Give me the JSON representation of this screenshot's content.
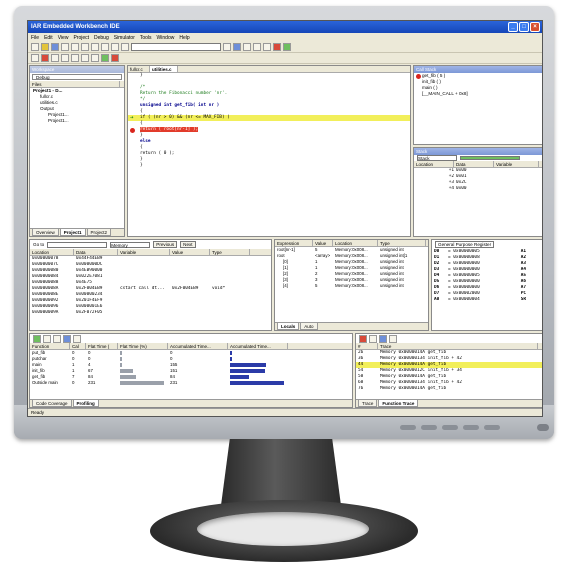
{
  "app": {
    "title": "IAR Embedded Workbench IDE"
  },
  "menu": [
    "File",
    "Edit",
    "View",
    "Project",
    "Debug",
    "Simulator",
    "Tools",
    "Window",
    "Help"
  ],
  "workspace": {
    "title": "Workspace",
    "config": "Debug",
    "files_header": "Files",
    "tree": [
      "Project1 - D...",
      "fullcr.c",
      "utilities.c",
      "Output",
      "Project1...",
      "Project1..."
    ],
    "tabs": [
      "Overview",
      "Project1",
      "Project2"
    ]
  },
  "editor": {
    "tabs": [
      "fullcr.c",
      "utilities.c"
    ],
    "lines": [
      "}",
      "",
      "/*",
      "   Return the Fibonacci number 'nr'.",
      "*/",
      "unsigned int get_fib( int nr )",
      "{",
      "  if ( (nr > 0) && (nr <= MAX_FIB) )",
      "  {",
      "    return ( root[nr-1] );",
      "  }",
      "  else",
      "  {",
      "    return ( 0 );",
      "  }",
      "}"
    ]
  },
  "callstack": {
    "title": "Call Stack",
    "items": [
      "get_fib ( 5 )",
      "init_fib ( )",
      "main ( )",
      "[__MAIN_CALL + 0x8]"
    ]
  },
  "stack": {
    "title": "Stack",
    "select": "Stack",
    "headers": [
      "Location",
      "Data",
      "Variable"
    ],
    "rows": [
      [
        "+1",
        "0x00",
        ""
      ],
      [
        "+2",
        "0x01",
        ""
      ],
      [
        "+3",
        "0x2C",
        ""
      ],
      [
        "+4",
        "0x00",
        ""
      ]
    ]
  },
  "memory": {
    "goto": "Go to",
    "select": "Memory",
    "prev": "Previous",
    "next": "Next",
    "headers": [
      "Location",
      "Data",
      "Variable",
      "Value",
      "Type"
    ],
    "rows": [
      [
        "0x00000078",
        "0x44F44EB9",
        "",
        "",
        ""
      ],
      [
        "0x0000007C",
        "0x000000DC",
        "",
        "",
        ""
      ],
      [
        "0x00000080",
        "0x4EB90000",
        "",
        "",
        ""
      ],
      [
        "0x00000084",
        "0x022E7081",
        "",
        "",
        ""
      ],
      [
        "0x00000088",
        "0x4E75",
        "",
        "",
        ""
      ],
      [
        "0x0000008A",
        "0x2F004EB9",
        "cstart call dt...",
        "0x2F004EB9",
        "void*"
      ],
      [
        "0x0000008E",
        "0x00000234",
        "",
        "",
        ""
      ],
      [
        "0x00000092",
        "0x201F4EF9",
        "",
        "",
        ""
      ],
      [
        "0x00000096",
        "0x000001E6",
        "",
        "",
        ""
      ],
      [
        "0x0000009A",
        "0x2F072F05",
        "",
        "",
        ""
      ]
    ]
  },
  "watch": {
    "headers": [
      "Expression",
      "Value",
      "Location",
      "Type"
    ],
    "rows": [
      [
        "root[nr-1]",
        "5",
        "Memory:0x008...",
        "unsigned int"
      ],
      [
        "root",
        "<array>",
        "Memory:0x008...",
        "unsigned int[1"
      ],
      [
        "[0]",
        "1",
        "Memory:0x008...",
        "unsigned int"
      ],
      [
        "[1]",
        "1",
        "Memory:0x008...",
        "unsigned int"
      ],
      [
        "[2]",
        "2",
        "Memory:0x008...",
        "unsigned int"
      ],
      [
        "[3]",
        "3",
        "Memory:0x008...",
        "unsigned int"
      ],
      [
        "[4]",
        "5",
        "Memory:0x008...",
        "unsigned int"
      ]
    ],
    "tabs": [
      "Locals",
      "Auto"
    ]
  },
  "registers": {
    "select": "General Purpose Register",
    "rows": [
      [
        "D0",
        "= 0x00000005",
        "A1"
      ],
      [
        "D1",
        "= 0x00000008",
        "A2"
      ],
      [
        "D2",
        "= 0x00000000",
        "A3"
      ],
      [
        "D3",
        "= 0x00000000",
        "A4"
      ],
      [
        "D4",
        "= 0x00000005",
        "A5"
      ],
      [
        "D5",
        "= 0x00000000",
        "A6"
      ],
      [
        "D6",
        "= 0x00000000",
        "A7"
      ],
      [
        "D7",
        "= 0x00002000",
        "PC"
      ],
      [
        "A0",
        "= 0x00000004",
        "SR"
      ]
    ]
  },
  "profiling": {
    "headers": [
      "Function",
      "Cal",
      "Flat Time (",
      "Flat Time (%)",
      "Accumulated Time...",
      "Accumulated Time..."
    ],
    "rows": [
      {
        "fn": "put_fib",
        "cal": "0",
        "flat": "0",
        "flat_pct": 0,
        "acc": "0",
        "acc_pct": 0
      },
      {
        "fn": "putchar",
        "cal": "0",
        "flat": "0",
        "flat_pct": 0,
        "acc": "0",
        "acc_pct": 0
      },
      {
        "fn": "main",
        "cal": "1",
        "flat": "4",
        "flat_pct": 2,
        "acc": "155",
        "acc_pct": 67
      },
      {
        "fn": "init_fib",
        "cal": "1",
        "flat": "67",
        "flat_pct": 29,
        "acc": "151",
        "acc_pct": 65
      },
      {
        "fn": "get_fib",
        "cal": "7",
        "flat": "84",
        "flat_pct": 36,
        "acc": "84",
        "acc_pct": 36
      },
      {
        "fn": "Outside main",
        "cal": "0",
        "flat": "231",
        "flat_pct": 100,
        "acc": "231",
        "acc_pct": 100
      }
    ],
    "tabs": [
      "Code Coverage",
      "Profiling"
    ]
  },
  "trace": {
    "headers": [
      "#",
      "Trace"
    ],
    "rows": [
      [
        "26",
        "Memory 0x0000014A  get_fib"
      ],
      [
        "36",
        "Memory 0x00000134 init_fib + 42"
      ],
      [
        "44",
        "Memory 0x0000014A  get_fib"
      ],
      [
        "54",
        "Memory 0x0000012C init_fib + 34"
      ],
      [
        "58",
        "Memory 0x0000014A  get_fib"
      ],
      [
        "68",
        "Memory 0x00000134 init_fib + 42"
      ],
      [
        "76",
        "Memory 0x0000014A  get_fib"
      ]
    ],
    "tabs": [
      "Trace",
      "Function Trace"
    ]
  },
  "status": "Ready"
}
